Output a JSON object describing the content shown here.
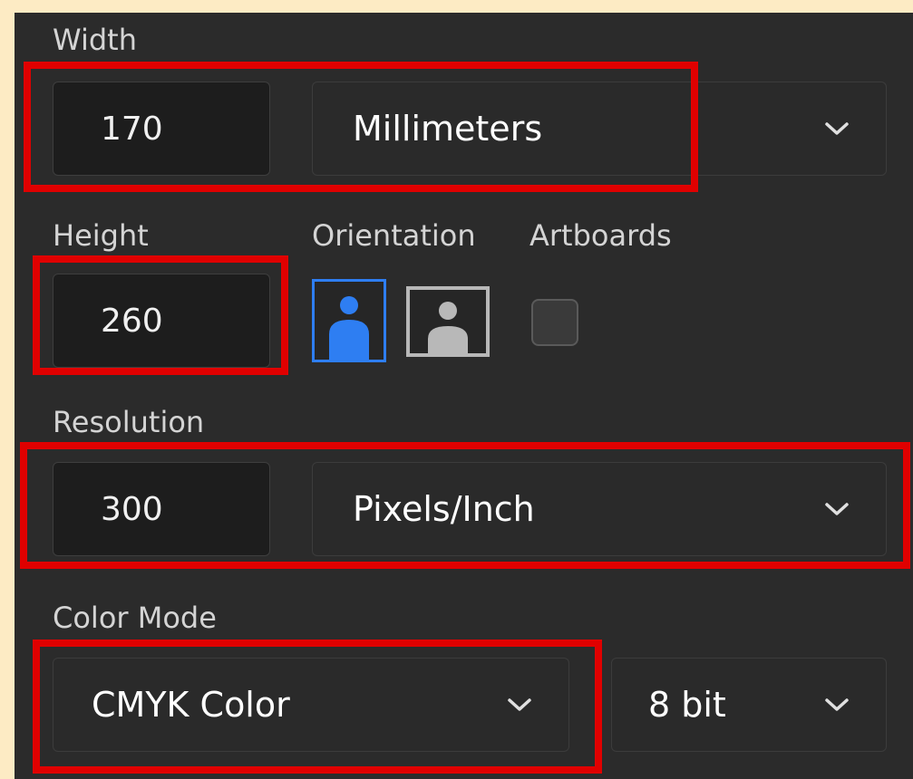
{
  "colors": {
    "page_background": "#fdebc4",
    "panel_background": "#2b2b2b",
    "highlight": "#e00000",
    "accent": "#2e7ef2"
  },
  "width": {
    "label": "Width",
    "value": "170",
    "unit": "Millimeters"
  },
  "height": {
    "label": "Height",
    "value": "260"
  },
  "orientation": {
    "label": "Orientation",
    "selected": "portrait",
    "portrait_icon": "portrait-icon",
    "landscape_icon": "landscape-icon"
  },
  "artboards": {
    "label": "Artboards",
    "checked": false
  },
  "resolution": {
    "label": "Resolution",
    "value": "300",
    "unit": "Pixels/Inch"
  },
  "color_mode": {
    "label": "Color Mode",
    "mode": "CMYK Color",
    "bit_depth": "8 bit"
  },
  "icons": {
    "dropdown": "chevron-down-icon"
  }
}
